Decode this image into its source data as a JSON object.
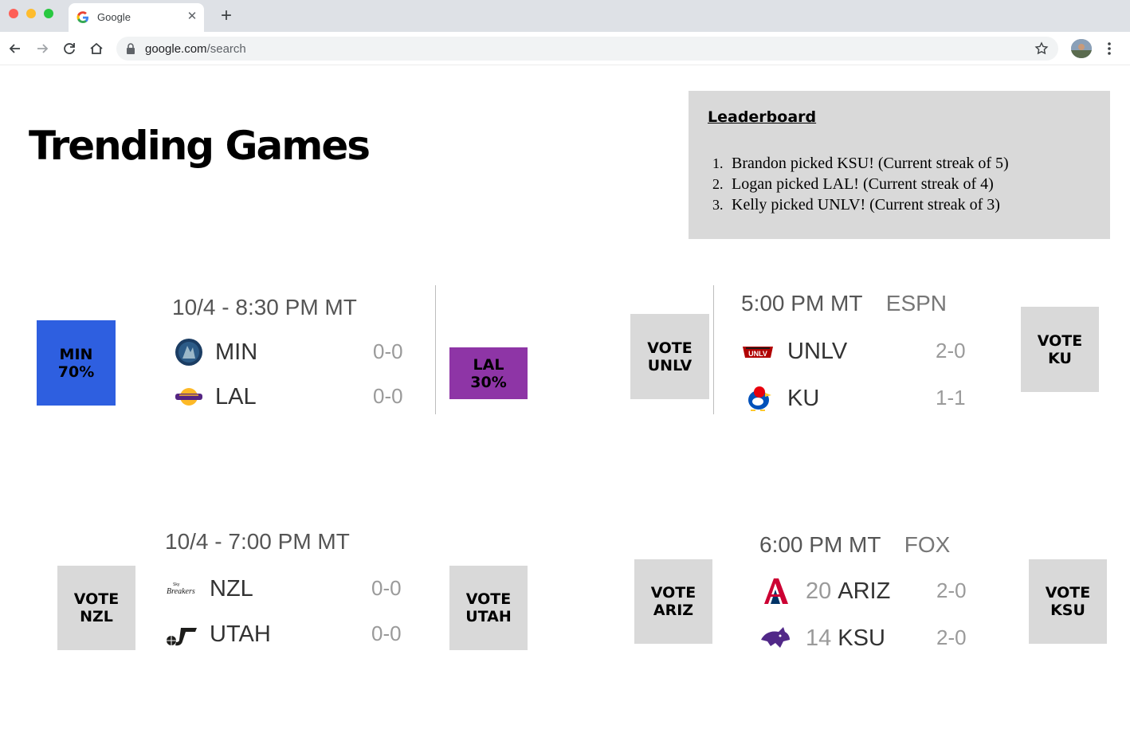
{
  "browser": {
    "tab_title": "Google",
    "url_host": "google.com",
    "url_path": "/search"
  },
  "page": {
    "title": "Trending Games"
  },
  "leaderboard": {
    "title": "Leaderboard",
    "items": [
      {
        "num": "1.",
        "text": "Brandon picked KSU! (Current streak of 5)"
      },
      {
        "num": "2.",
        "text": "Logan picked LAL! (Current streak of 4)"
      },
      {
        "num": "3.",
        "text": "Kelly picked UNLV! (Current streak of 3)"
      }
    ]
  },
  "games": [
    {
      "header": "10/4  - 8:30 PM MT",
      "network": "",
      "teams": [
        {
          "rank": "",
          "name": "MIN",
          "record": "0-0",
          "logo": "timberwolves-logo"
        },
        {
          "rank": "",
          "name": "LAL",
          "record": "0-0",
          "logo": "lakers-logo"
        }
      ],
      "left_button": {
        "line1": "MIN",
        "line2": "70%",
        "color": "#2e5fe0"
      },
      "right_button": {
        "line1": "LAL",
        "line2": "30%",
        "color": "#8e35a6"
      }
    },
    {
      "header": "5:00 PM MT",
      "network": "ESPN",
      "teams": [
        {
          "rank": "",
          "name": "UNLV",
          "record": "2-0",
          "logo": "unlv-logo"
        },
        {
          "rank": "",
          "name": "KU",
          "record": "1-1",
          "logo": "jayhawk-logo"
        }
      ],
      "left_button": {
        "line1": "VOTE",
        "line2": "UNLV"
      },
      "right_button": {
        "line1": "VOTE",
        "line2": "KU"
      }
    },
    {
      "header": "10/4  - 7:00 PM MT",
      "network": "",
      "teams": [
        {
          "rank": "",
          "name": "NZL",
          "record": "0-0",
          "logo": "breakers-logo"
        },
        {
          "rank": "",
          "name": "UTAH",
          "record": "0-0",
          "logo": "jazz-logo"
        }
      ],
      "left_button": {
        "line1": "VOTE",
        "line2": "NZL"
      },
      "right_button": {
        "line1": "VOTE",
        "line2": "UTAH"
      }
    },
    {
      "header": "6:00 PM MT",
      "network": "FOX",
      "teams": [
        {
          "rank": "20",
          "name": "ARIZ",
          "record": "2-0",
          "logo": "arizona-logo"
        },
        {
          "rank": "14",
          "name": "KSU",
          "record": "2-0",
          "logo": "wildcat-logo"
        }
      ],
      "left_button": {
        "line1": "VOTE",
        "line2": "ARIZ"
      },
      "right_button": {
        "line1": "VOTE",
        "line2": "KSU"
      }
    }
  ]
}
